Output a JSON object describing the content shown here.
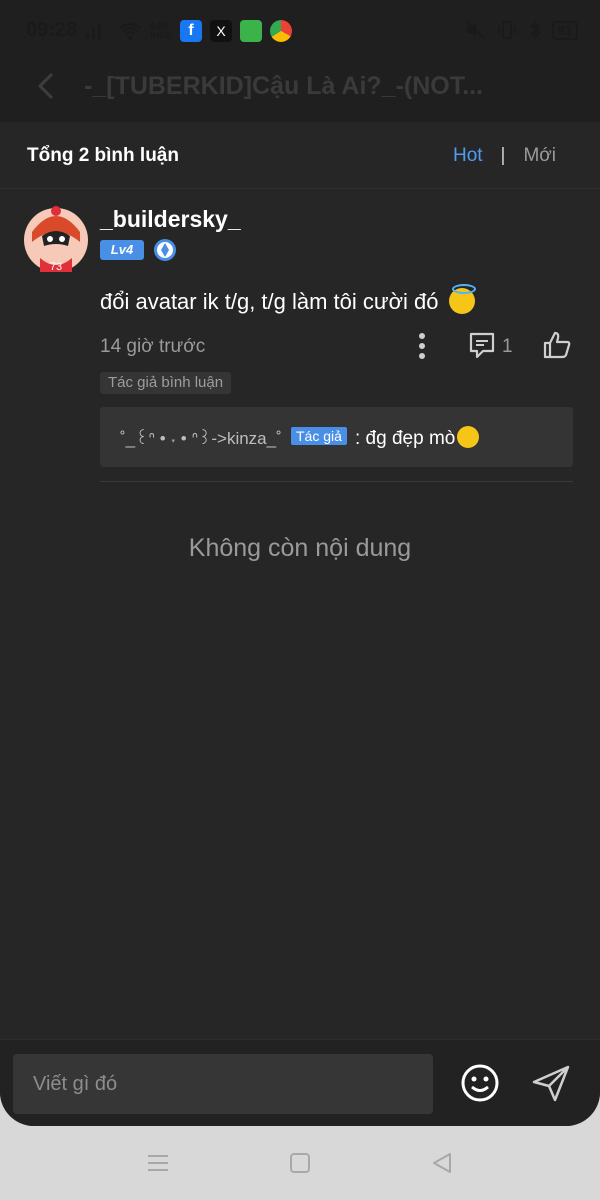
{
  "status": {
    "time": "09:28",
    "speed": "6.00 KB/S",
    "battery": "91"
  },
  "header": {
    "title": "-_[TUBERKID]Cậu Là Ai?_-(NOT..."
  },
  "comments_bar": {
    "total": "Tổng 2 bình luận",
    "sort_hot": "Hot",
    "sort_sep": "|",
    "sort_new": "Mới"
  },
  "comment": {
    "username": "_buildersky_",
    "level": "Lv4",
    "text": "đổi avatar ik t/g, t/g làm tôi cười đó",
    "time": "14 giờ trước",
    "reply_count": "1",
    "author_tag": "Tác giả bình luận",
    "reply": {
      "user": "˚_꒰ᐢ • ˕ • ᐢ꒱->kinza_˚",
      "tag": "Tác giả",
      "text": ": đg đẹp mò"
    }
  },
  "end_text": "Không còn nội dung",
  "compose": {
    "placeholder": "Viết gì đó"
  },
  "colors": {
    "accent": "#4f9cf0",
    "background": "#262626",
    "level_badge": "#4a8fe6"
  }
}
